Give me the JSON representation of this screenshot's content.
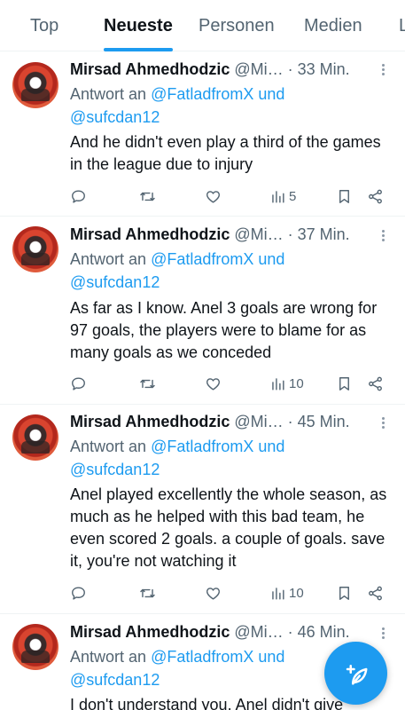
{
  "tabs": [
    {
      "label": "Top",
      "active": false
    },
    {
      "label": "Neueste",
      "active": true
    },
    {
      "label": "Personen",
      "active": false
    },
    {
      "label": "Medien",
      "active": false
    },
    {
      "label": "L",
      "active": false
    }
  ],
  "colors": {
    "accent": "#1d9bf0",
    "text": "#0f1419",
    "muted": "#536471"
  },
  "reply_prefix": "Antwort an",
  "mention_1": "@FatladfromX und",
  "mention_2": "@sufcdan12",
  "tweets": [
    {
      "name": "Mirsad Ahmedhodzic",
      "handle": "@Mi…",
      "time": "· 33 Min.",
      "text": "And he didn't even play a third of the games in the league due to injury",
      "views": "5"
    },
    {
      "name": "Mirsad Ahmedhodzic",
      "handle": "@Mi…",
      "time": "· 37 Min.",
      "text": "As far as I know. Anel 3 goals are wrong for 97 goals, the players were to blame for as many goals as we conceded",
      "views": "10"
    },
    {
      "name": "Mirsad Ahmedhodzic",
      "handle": "@Mi…",
      "time": "· 45 Min.",
      "text": "Anel played excellently the whole season, as much as he helped with this bad team, he even scored 2 goals. a couple of goals. save it, you're not watching it",
      "views": "10"
    },
    {
      "name": "Mirsad Ahmedhodzic",
      "handle": "@Mi…",
      "time": "· 46 Min.",
      "text": "I don't understand you. Anel didn't give"
    }
  ],
  "fab_icon": "compose-feather-plus-icon"
}
